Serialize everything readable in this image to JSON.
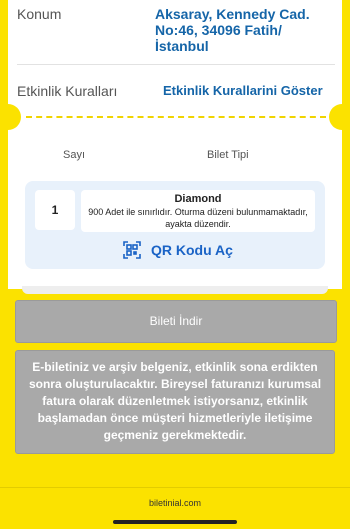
{
  "details": {
    "location_label": "Konum",
    "location_value": "Aksaray, Kennedy Cad. No:46, 34096 Fatih/ İstanbul",
    "rules_label": "Etkinlik Kuralları",
    "rules_link": "Etkinlik Kurallarini Göster"
  },
  "tickets": {
    "col_count": "Sayı",
    "col_type": "Bilet Tipi",
    "items": [
      {
        "count": "1",
        "type": "Diamond",
        "description": "900 Adet ile sınırlıdır. Oturma düzeni bulunmamaktadır, ayakta düzendir."
      }
    ],
    "qr_button": "QR Kodu Aç",
    "qr_icon": "qr-code-icon"
  },
  "download_button": "Bileti İndir",
  "notice": "E-biletiniz ve arşiv belgeniz, etkinlik sona erdikten sonra oluşturulacaktır. Bireysel faturanızı kurumsal fatura olarak düzenletmek istiyorsanız, etkinlik başlamadan önce müşteri hizmetleriyle iletişime geçmeniz gerekmektedir.",
  "footer": "biletinial.com",
  "colors": {
    "background": "#fbe200",
    "link": "#1565a8",
    "button_gray": "#a9a9a9",
    "ticket_panel": "#e8f1fb"
  }
}
